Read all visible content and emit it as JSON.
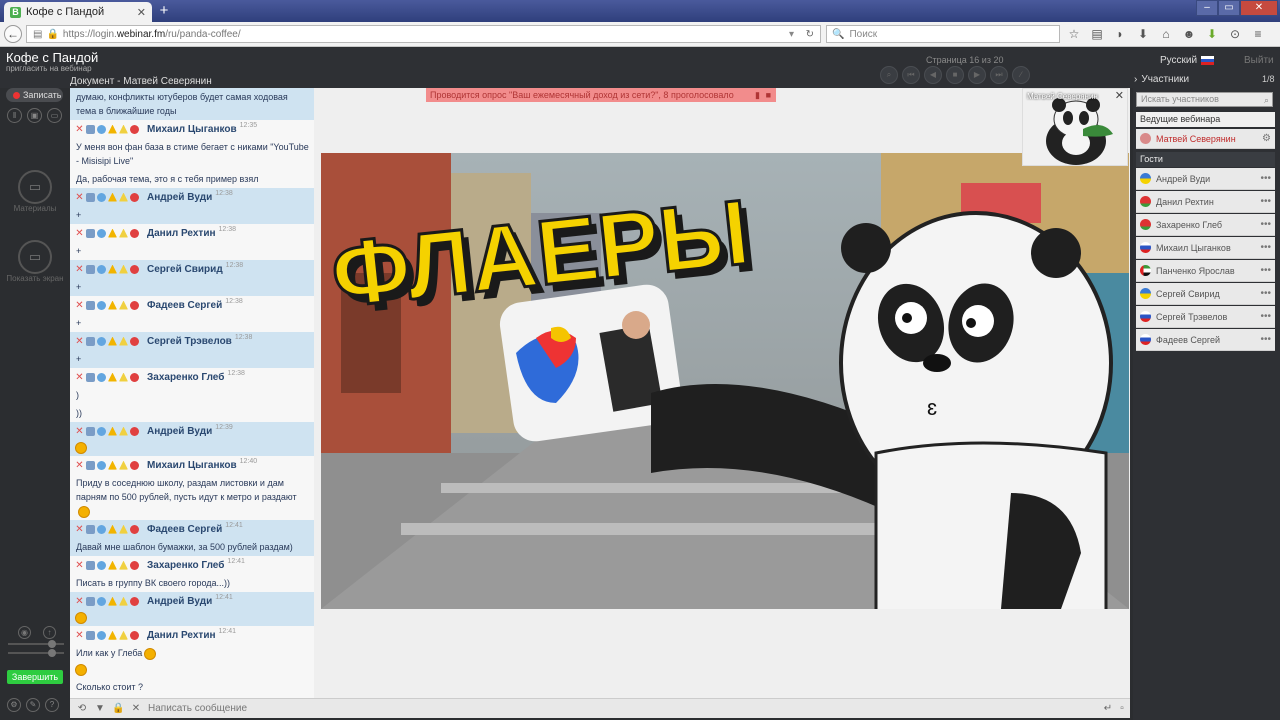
{
  "browser": {
    "tab_title": "Кофе с Пандой",
    "url_prefix": "https://login.",
    "url_domain": "webinar.fm",
    "url_path": "/ru/panda-coffee/",
    "search_placeholder": "Поиск"
  },
  "app": {
    "title": "Кофе с Пандой",
    "subtitle": "пригласить на вебинар",
    "page_info": "Страница 16 из 20",
    "language": "Русский",
    "exit": "Выйти",
    "document_title": "Документ - Матвей Северянин",
    "participants_title": "Участники",
    "participants_count": "1/8"
  },
  "leftbar": {
    "record": "Записать",
    "materials": "Материалы",
    "show_screen": "Показать экран",
    "finish": "Завершить"
  },
  "chat": {
    "messages": [
      {
        "type": "text",
        "text": "думаю, конфликты ютуберов будет самая ходовая тема в ближайшие годы",
        "hl": true
      },
      {
        "type": "head",
        "name": "Михаил Цыганков",
        "time": "12:35",
        "hl": false
      },
      {
        "type": "text",
        "text": "У меня вон фан база в стиме бегает с никами \"YouTube - Misisipi Live\"",
        "hl": false
      },
      {
        "type": "text",
        "text": "Да, рабочая тема, это я с тебя пример взял",
        "hl": false
      },
      {
        "type": "head",
        "name": "Андрей Вуди",
        "time": "12:38",
        "hl": true
      },
      {
        "type": "text",
        "text": "+",
        "hl": true
      },
      {
        "type": "head",
        "name": "Данил Рехтин",
        "time": "12:38",
        "hl": false
      },
      {
        "type": "text",
        "text": "+",
        "hl": false
      },
      {
        "type": "head",
        "name": "Сергей Свирид",
        "time": "12:38",
        "hl": true
      },
      {
        "type": "text",
        "text": "+",
        "hl": true
      },
      {
        "type": "head",
        "name": "Фадеев Сергей",
        "time": "12:38",
        "hl": false
      },
      {
        "type": "text",
        "text": "+",
        "hl": false
      },
      {
        "type": "head",
        "name": "Сергей Трэвелов",
        "time": "12:38",
        "hl": true
      },
      {
        "type": "text",
        "text": "+",
        "hl": true
      },
      {
        "type": "head",
        "name": "Захаренко Глеб",
        "time": "12:38",
        "hl": false
      },
      {
        "type": "text",
        "text": ")",
        "hl": false
      },
      {
        "type": "text",
        "text": "))",
        "hl": false
      },
      {
        "type": "head",
        "name": "Андрей Вуди",
        "time": "12:39",
        "hl": true
      },
      {
        "type": "emoji",
        "hl": true
      },
      {
        "type": "head",
        "name": "Михаил Цыганков",
        "time": "12:40",
        "hl": false
      },
      {
        "type": "text",
        "text": "Приду в соседнюю школу, раздам листовки и дам парням по 500 рублей, пусть идут к метро и раздают",
        "emoji": true,
        "hl": false
      },
      {
        "type": "head",
        "name": "Фадеев Сергей",
        "time": "12:41",
        "hl": true
      },
      {
        "type": "text",
        "text": "Давай мне шаблон бумажки, за 500 рублей раздам)",
        "hl": true
      },
      {
        "type": "head",
        "name": "Захаренко Глеб",
        "time": "12:41",
        "hl": false
      },
      {
        "type": "text",
        "text": "Писать в группу ВК своего города...))",
        "hl": false
      },
      {
        "type": "head",
        "name": "Андрей Вуди",
        "time": "12:41",
        "hl": true
      },
      {
        "type": "emoji",
        "hl": true
      },
      {
        "type": "head",
        "name": "Данил Рехтин",
        "time": "12:41",
        "hl": false
      },
      {
        "type": "text",
        "text": "Или как у Глеба",
        "emoji": true,
        "hl": false
      },
      {
        "type": "emoji",
        "hl": false
      },
      {
        "type": "text",
        "text": "Сколько стоит ?",
        "hl": false
      }
    ],
    "input_placeholder": "Написать сообщение"
  },
  "stage": {
    "poll_text": "Проводится опрос \"Ваш ежемесячный доход из сети?\", 8 проголосовало",
    "slide_title": "ФЛАЕРЫ",
    "camera_name": "Матвей Северянин"
  },
  "participants": {
    "search_placeholder": "Искать участников",
    "hosts_label": "Ведущие вебинара",
    "host": "Матвей Северянин",
    "guests_label": "Гости",
    "guests": [
      {
        "name": "Андрей Вуди",
        "flag": "ua"
      },
      {
        "name": "Данил Рехтин",
        "flag": "by"
      },
      {
        "name": "Захаренко Глеб",
        "flag": "by"
      },
      {
        "name": "Михаил Цыганков",
        "flag": "ru"
      },
      {
        "name": "Панченко Ярослав",
        "flag": "ae"
      },
      {
        "name": "Сергей Свирид",
        "flag": "ua"
      },
      {
        "name": "Сергей Трэвелов",
        "flag": "ru"
      },
      {
        "name": "Фадеев Сергей",
        "flag": "ru"
      }
    ]
  }
}
